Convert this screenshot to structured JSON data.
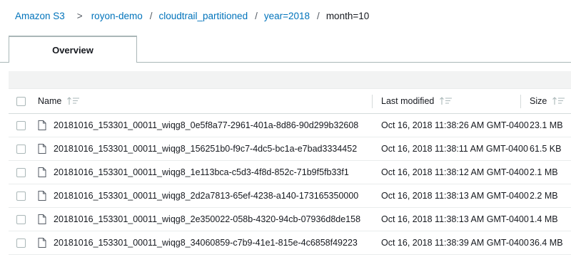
{
  "breadcrumb": {
    "items": [
      {
        "label": "Amazon S3"
      },
      {
        "label": "royon-demo"
      },
      {
        "label": "cloudtrail_partitioned"
      },
      {
        "label": "year=2018"
      }
    ],
    "current": "month=10",
    "separators": [
      ">",
      "/",
      "/",
      "/"
    ]
  },
  "tabs": {
    "overview_label": "Overview"
  },
  "table": {
    "columns": {
      "name": "Name",
      "modified": "Last modified",
      "size": "Size"
    },
    "rows": [
      {
        "name": "20181016_153301_00011_wiqg8_0e5f8a77-2961-401a-8d86-90d299b32608",
        "modified": "Oct 16, 2018 11:38:26 AM GMT-0400",
        "size": "23.1 MB"
      },
      {
        "name": "20181016_153301_00011_wiqg8_156251b0-f9c7-4dc5-bc1a-e7bad3334452",
        "modified": "Oct 16, 2018 11:38:11 AM GMT-0400",
        "size": "61.5 KB"
      },
      {
        "name": "20181016_153301_00011_wiqg8_1e113bca-c5d3-4f8d-852c-71b9f5fb33f1",
        "modified": "Oct 16, 2018 11:38:12 AM GMT-0400",
        "size": "2.1 MB"
      },
      {
        "name": "20181016_153301_00011_wiqg8_2d2a7813-65ef-4238-a140-173165350000",
        "modified": "Oct 16, 2018 11:38:13 AM GMT-0400",
        "size": "2.2 MB"
      },
      {
        "name": "20181016_153301_00011_wiqg8_2e350022-058b-4320-94cb-07936d8de158",
        "modified": "Oct 16, 2018 11:38:13 AM GMT-0400",
        "size": "1.4 MB"
      },
      {
        "name": "20181016_153301_00011_wiqg8_34060859-c7b9-41e1-815e-4c6858f49223",
        "modified": "Oct 16, 2018 11:38:39 AM GMT-0400",
        "size": "36.4 MB"
      }
    ]
  },
  "icons": {
    "file": "file-icon",
    "sort": "sort-icon",
    "checkbox": "checkbox"
  },
  "colors": {
    "link": "#0073bb",
    "border": "#aab7b8",
    "band": "#f2f3f3"
  }
}
